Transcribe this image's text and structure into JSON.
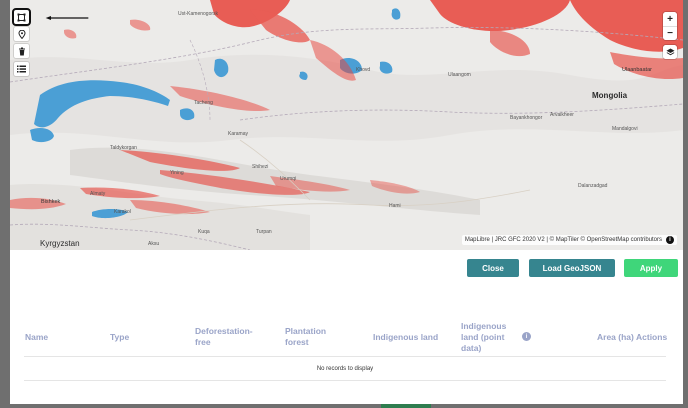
{
  "map": {
    "labels": {
      "country_mongolia": "Mongolia",
      "country_kyrgyzstan": "Kyrgyzstan",
      "city_ulaanbaatar": "Ulaanbaatar",
      "city_bishkek": "Bishkek",
      "city_karamay": "Karamay",
      "city_hami": "Hami",
      "city_tacheng": "Tacheng",
      "city_ust_kamenogorsk": "Ust-Kamenogorsk",
      "city_khovd": "Khovd",
      "city_ulaangom": "Ulaangom",
      "city_bayankhongor": "Bayankhongor",
      "city_arvaikheer": "Arvaikheer",
      "city_mandalgovi": "Mandalgovi",
      "city_dalanzadgad": "Dalanzadgad",
      "city_shihezi": "Shihezi",
      "city_urumqi": "Urumqi",
      "city_yining": "Yining",
      "city_taldykorgan": "Taldykorgan",
      "city_almaty": "Almaty",
      "city_karakol": "Karakol",
      "city_kuqa": "Kuqa",
      "city_aksu": "Aksu",
      "city_turpan": "Turpan"
    },
    "attribution": "MapLibre | JRC GFC 2020 V2 | © MapTiler © OpenStreetMap contributors",
    "controls": {
      "zoom_in": "+",
      "zoom_out": "−"
    },
    "colors": {
      "deforestation": "#e8453c",
      "water": "#4b9fd5",
      "land": "#ecebe9"
    }
  },
  "buttons": {
    "close": "Close",
    "load_geojson": "Load GeoJSON",
    "apply": "Apply"
  },
  "table": {
    "columns": {
      "name": "Name",
      "type": "Type",
      "deforestation_free": "Deforestation-free",
      "plantation_forest": "Plantation forest",
      "indigenous_land": "Indigenous land",
      "indigenous_land_point": "Indigenous land (point data)",
      "area": "Area (ha)",
      "actions": "Actions"
    },
    "empty_message": "No records to display"
  }
}
